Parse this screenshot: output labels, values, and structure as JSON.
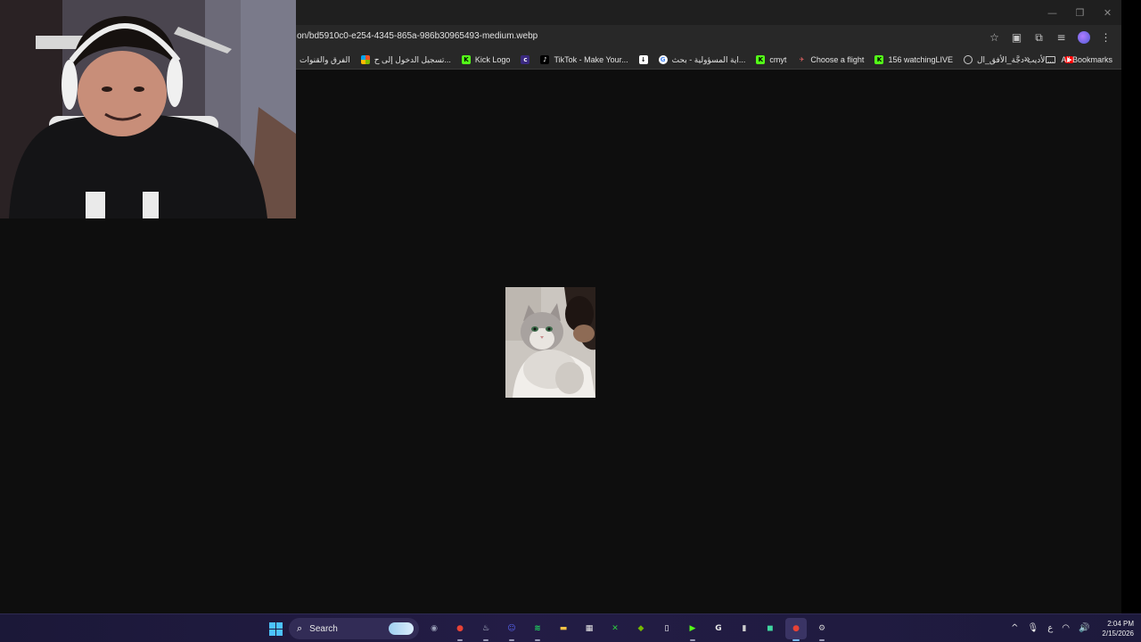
{
  "window": {
    "controls": {
      "minimize": "—",
      "restore": "❐",
      "close": "✕"
    }
  },
  "address_bar": {
    "url": "on/bd5910c0-e254-4345-865a-986b30965493-medium.webp"
  },
  "toolbar_icons": [
    "star-icon",
    "media-icon",
    "extensions-icon",
    "tab-search-icon",
    "profile-avatar",
    "menu-icon"
  ],
  "bookmarks": [
    {
      "label": "الفرق والقنوات",
      "favicon": "none"
    },
    {
      "label": "تسجيل الدخول إلى ح...",
      "favicon": "microsoft"
    },
    {
      "label": "Kick Logo",
      "favicon": "kick"
    },
    {
      "label": "",
      "favicon": "c"
    },
    {
      "label": "TikTok - Make Your...",
      "favicon": "tiktok"
    },
    {
      "label": "",
      "favicon": "download"
    },
    {
      "label": "اية المسؤولية - بحث...",
      "favicon": "google"
    },
    {
      "label": "cmyt",
      "favicon": "kick"
    },
    {
      "label": "Choose a flight",
      "favicon": "flight"
    },
    {
      "label": "156 watchingLIVE",
      "favicon": "kick"
    },
    {
      "label": "الأديب-دجَّة_الأفق_ال...",
      "favicon": "globe"
    },
    {
      "label": "",
      "favicon": "youtube"
    }
  ],
  "all_bookmarks_label": "All Bookmarks",
  "viewer": {
    "image_description_name": "cat-photo"
  },
  "taskbar": {
    "search_label": "Search",
    "apps": [
      {
        "name": "camera",
        "glyph": "◉",
        "color": "#9aa0b8"
      },
      {
        "name": "chrome",
        "glyph": "●",
        "color": "#e84235"
      },
      {
        "name": "steam",
        "glyph": "♨",
        "color": "#c7d5e0"
      },
      {
        "name": "discord",
        "glyph": "☺",
        "color": "#5865f2"
      },
      {
        "name": "spotify",
        "glyph": "≋",
        "color": "#1ed760"
      },
      {
        "name": "file-explorer",
        "glyph": "▬",
        "color": "#f6c344"
      },
      {
        "name": "microsoft-store",
        "glyph": "▦",
        "color": "#e8e8e8"
      },
      {
        "name": "xbox",
        "glyph": "✕",
        "color": "#2ecc40"
      },
      {
        "name": "nvidia",
        "glyph": "◆",
        "color": "#76b900"
      },
      {
        "name": "notepad",
        "glyph": "▯",
        "color": "#ffffff"
      },
      {
        "name": "play",
        "glyph": "▶",
        "color": "#53fc18"
      },
      {
        "name": "g-hub",
        "glyph": "G",
        "color": "#e8e8e8"
      },
      {
        "name": "battery-app",
        "glyph": "▮",
        "color": "#cfcfcf"
      },
      {
        "name": "app-green",
        "glyph": "◼",
        "color": "#3fd6a0"
      },
      {
        "name": "chrome-active",
        "glyph": "●",
        "color": "#e84235"
      },
      {
        "name": "settings",
        "glyph": "⚙",
        "color": "#cfcfcf"
      }
    ],
    "tray": {
      "chevron": "^",
      "mic": "🎤",
      "language": "ع",
      "wifi": "wifi-icon",
      "volume": "volume-icon",
      "time": "2:04 PM",
      "date": "2/15/2026"
    }
  }
}
